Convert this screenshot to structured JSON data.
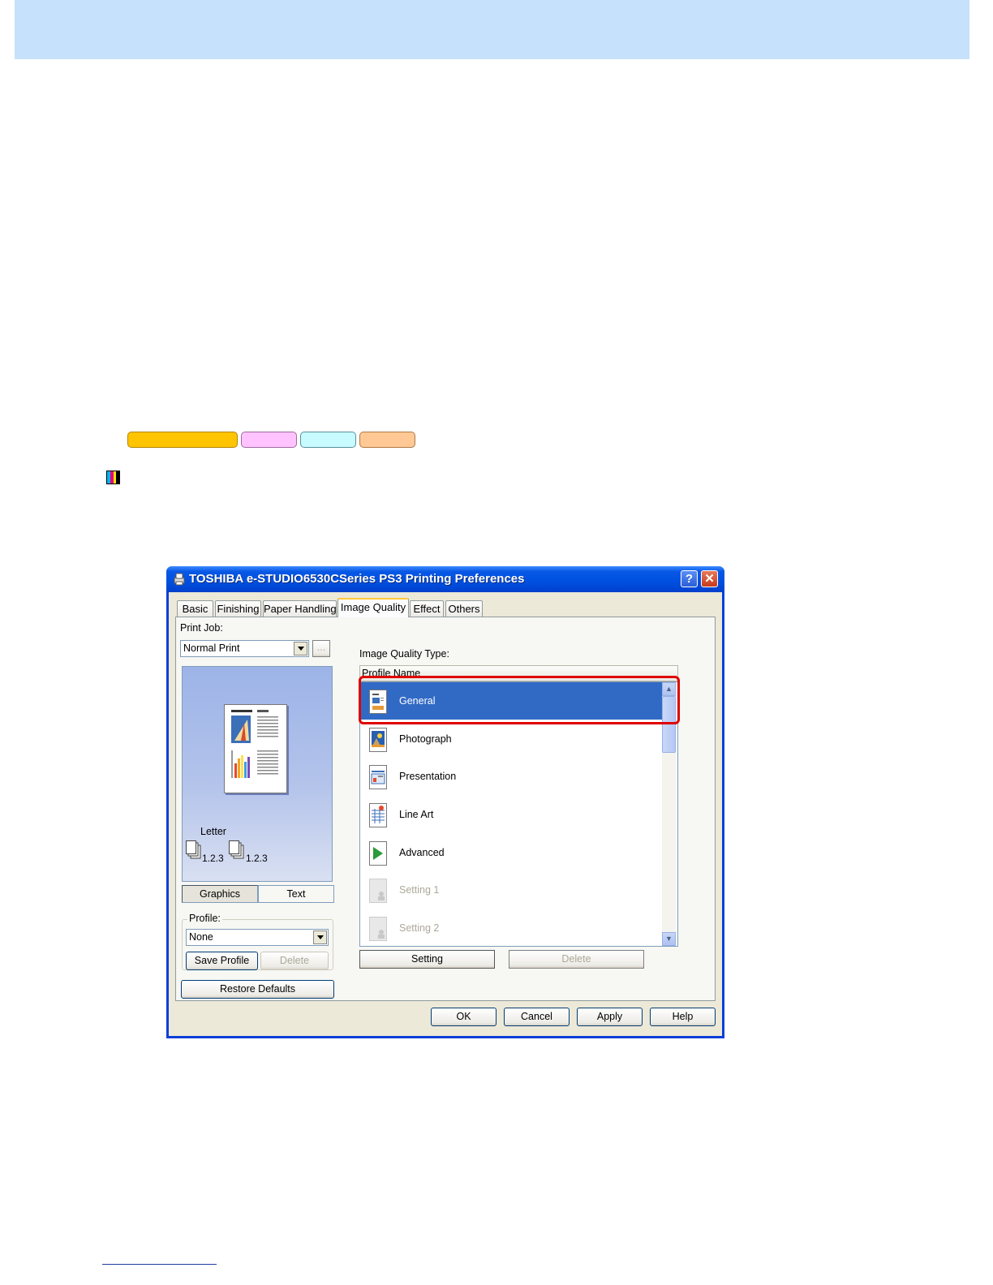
{
  "dialog": {
    "title": "TOSHIBA e-STUDIO6530CSeries PS3 Printing Preferences",
    "help_button": "?",
    "close_button": "✕",
    "tabs": [
      {
        "label": "Basic"
      },
      {
        "label": "Finishing"
      },
      {
        "label": "Paper Handling"
      },
      {
        "label": "Image Quality",
        "active": true
      },
      {
        "label": "Effect"
      },
      {
        "label": "Others"
      }
    ],
    "print_job": {
      "label": "Print Job:",
      "value": "Normal Print",
      "more_button": "..."
    },
    "preview": {
      "paper_size": "Letter",
      "copies_label_1": "1.2.3",
      "copies_label_2": "1.2.3"
    },
    "view_toggle": {
      "graphics": "Graphics",
      "text": "Text"
    },
    "profile": {
      "label": "Profile:",
      "value": "None",
      "save_button": "Save Profile",
      "delete_button": "Delete"
    },
    "restore_defaults": "Restore Defaults",
    "image_quality": {
      "label": "Image Quality Type:",
      "column_header": "Profile Name",
      "items": [
        {
          "name": "General",
          "icon": "general-icon",
          "selected": true
        },
        {
          "name": "Photograph",
          "icon": "photograph-icon"
        },
        {
          "name": "Presentation",
          "icon": "presentation-icon"
        },
        {
          "name": "Line Art",
          "icon": "line-art-icon"
        },
        {
          "name": "Advanced",
          "icon": "advanced-icon"
        },
        {
          "name": "Setting 1",
          "icon": "setting-icon",
          "disabled": true
        },
        {
          "name": "Setting 2",
          "icon": "setting-icon",
          "disabled": true
        }
      ],
      "setting_button": "Setting",
      "delete_button": "Delete"
    },
    "footer": {
      "ok": "OK",
      "cancel": "Cancel",
      "apply": "Apply",
      "help": "Help"
    }
  },
  "colors": {
    "chip_1": "#ffc400",
    "chip_2": "#ffc4ff",
    "chip_3": "#c7fbff",
    "chip_4": "#ffc894",
    "header_band": "#c6e1fb",
    "selection": "#316ac5",
    "callout": "#e00000"
  }
}
